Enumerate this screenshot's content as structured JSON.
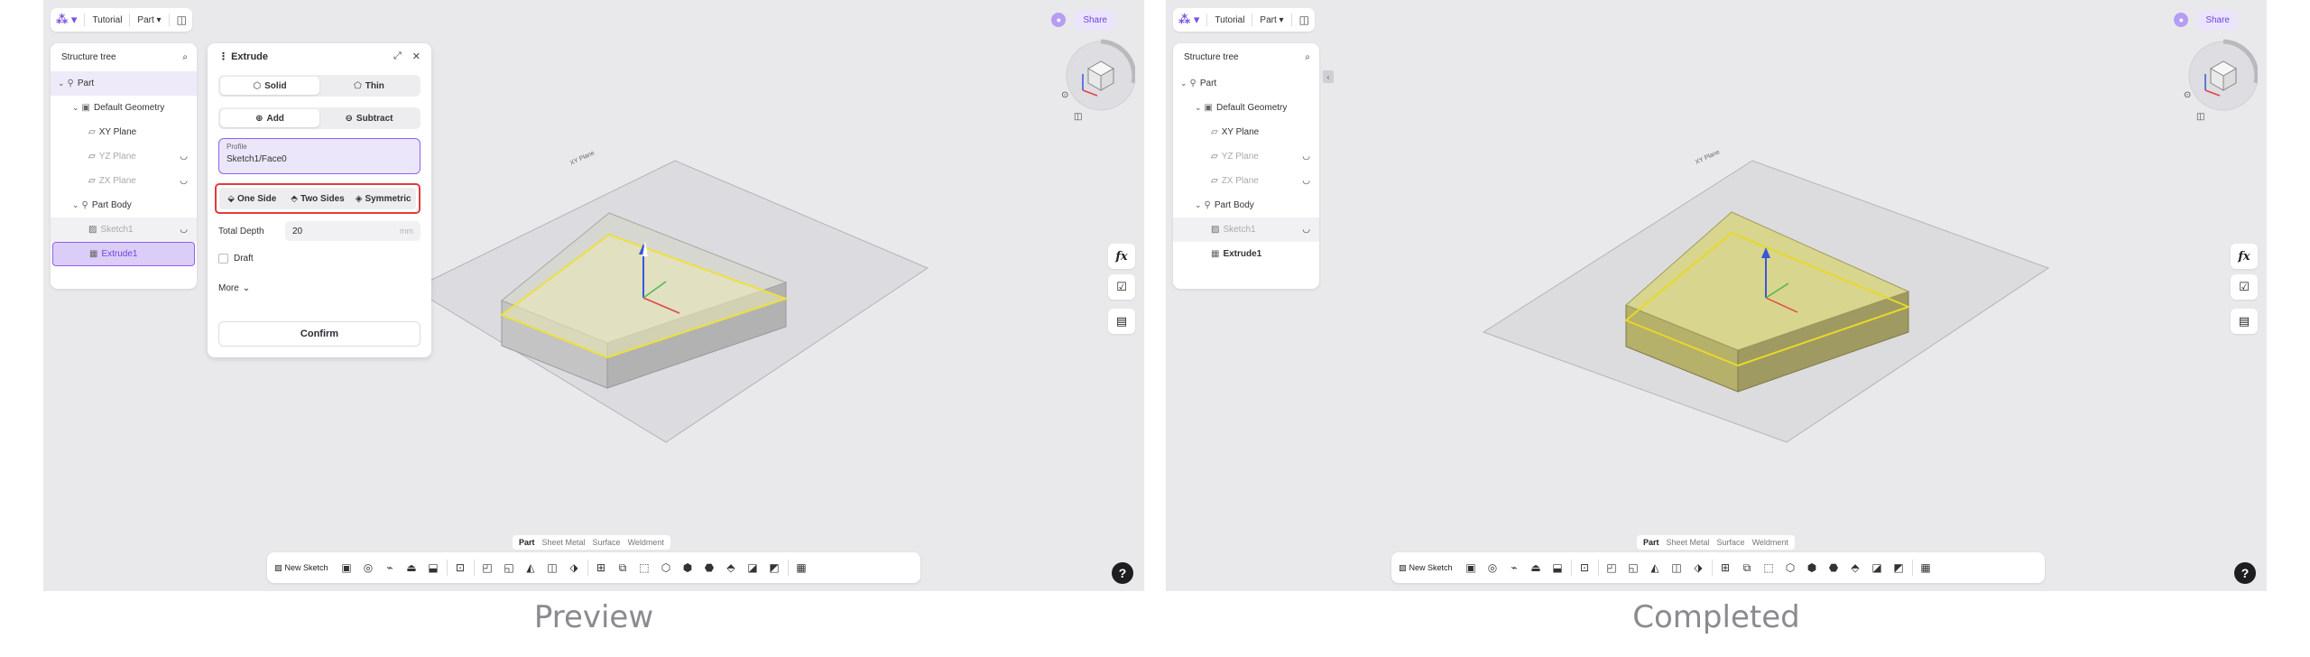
{
  "captions": {
    "left": "Preview",
    "right": "Completed"
  },
  "topbar": {
    "breadcrumb_project": "Tutorial",
    "breadcrumb_part": "Part",
    "share_label": "Share"
  },
  "tree": {
    "title": "Structure tree",
    "items": [
      {
        "label": "Part"
      },
      {
        "label": "Default Geometry"
      },
      {
        "label": "XY Plane"
      },
      {
        "label": "YZ Plane"
      },
      {
        "label": "ZX Plane"
      },
      {
        "label": "Part Body"
      },
      {
        "label": "Sketch1"
      },
      {
        "label": "Extrude1"
      }
    ]
  },
  "extrude_panel": {
    "title": "Extrude",
    "body_types": [
      "Solid",
      "Thin"
    ],
    "operations": [
      "Add",
      "Subtract"
    ],
    "profile_label": "Profile",
    "profile_value": "Sketch1/Face0",
    "directions": [
      "One Side",
      "Two Sides",
      "Symmetric"
    ],
    "depth_label": "Total Depth",
    "depth_value": "20",
    "depth_unit": "mm",
    "draft_label": "Draft",
    "more_label": "More",
    "confirm_label": "Confirm"
  },
  "viewport": {
    "plane_label": "XY Plane"
  },
  "side_tools": [
    "fx-icon",
    "checklist-icon",
    "table-icon"
  ],
  "mode_tabs": [
    "Part",
    "Sheet Metal",
    "Surface",
    "Weldment"
  ],
  "feature_bar": {
    "new_sketch_label": "New Sketch"
  },
  "help_label": "?"
}
